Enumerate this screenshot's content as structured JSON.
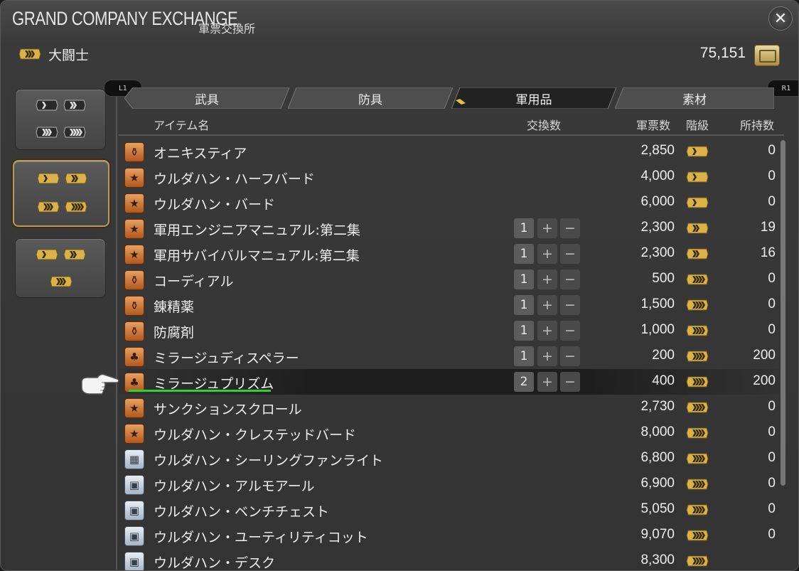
{
  "window": {
    "title": "GRAND COMPANY EXCHANGE",
    "subtitle": "軍票交換所",
    "close_icon": "close-icon"
  },
  "player": {
    "rank_name": "大闘士",
    "seals": "75,151"
  },
  "side": {
    "groups": [
      {
        "name": "rank-group-1",
        "active": false
      },
      {
        "name": "rank-group-2",
        "active": true
      },
      {
        "name": "rank-group-3",
        "active": false
      }
    ]
  },
  "controls": {
    "l1": "L1",
    "r1": "R1"
  },
  "tabs": [
    {
      "label": "武具",
      "active": false
    },
    {
      "label": "防具",
      "active": false
    },
    {
      "label": "軍用品",
      "active": true
    },
    {
      "label": "素材",
      "active": false
    }
  ],
  "columns": {
    "name": "アイテム名",
    "exchange": "交換数",
    "cost": "軍票数",
    "rank": "階級",
    "owned": "所持数"
  },
  "items": [
    {
      "name": "オニキスティア",
      "icon": "potion-icon",
      "color": "orange",
      "qty": "",
      "cost": "2,850",
      "rank": 1,
      "owned": "0"
    },
    {
      "name": "ウルダハン・ハーフバード",
      "icon": "star-icon",
      "color": "orange",
      "qty": "",
      "cost": "4,000",
      "rank": 1,
      "owned": "0"
    },
    {
      "name": "ウルダハン・バード",
      "icon": "star-icon",
      "color": "orange",
      "qty": "",
      "cost": "6,000",
      "rank": 1,
      "owned": "0"
    },
    {
      "name": "軍用エンジニアマニュアル:第二集",
      "icon": "star-icon",
      "color": "orange",
      "qty": "1",
      "cost": "2,300",
      "rank": 2,
      "owned": "19"
    },
    {
      "name": "軍用サバイバルマニュアル:第二集",
      "icon": "star-icon",
      "color": "orange",
      "qty": "1",
      "cost": "2,300",
      "rank": 2,
      "owned": "16"
    },
    {
      "name": "コーディアル",
      "icon": "potion-icon",
      "color": "orange",
      "qty": "1",
      "cost": "500",
      "rank": 3,
      "owned": "0"
    },
    {
      "name": "錬精薬",
      "icon": "potion-icon",
      "color": "orange",
      "qty": "1",
      "cost": "1,500",
      "rank": 3,
      "owned": "0"
    },
    {
      "name": "防腐剤",
      "icon": "potion-icon",
      "color": "orange",
      "qty": "1",
      "cost": "1,000",
      "rank": 3,
      "owned": "0"
    },
    {
      "name": "ミラージュディスペラー",
      "icon": "crystal-icon",
      "color": "orange",
      "qty": "1",
      "cost": "200",
      "rank": 3,
      "owned": "200"
    },
    {
      "name": "ミラージュプリズム",
      "icon": "crystal-icon",
      "color": "orange",
      "qty": "2",
      "cost": "400",
      "rank": 3,
      "owned": "200",
      "selected": true
    },
    {
      "name": "サンクションスクロール",
      "icon": "star-icon",
      "color": "orange",
      "qty": "",
      "cost": "2,730",
      "rank": 3,
      "owned": "0"
    },
    {
      "name": "ウルダハン・クレステッドバード",
      "icon": "star-icon",
      "color": "orange",
      "qty": "",
      "cost": "8,000",
      "rank": 3,
      "owned": "0"
    },
    {
      "name": "ウルダハン・シーリングファンライト",
      "icon": "ceiling-light-icon",
      "color": "blue",
      "qty": "",
      "cost": "6,800",
      "rank": 3,
      "owned": "0"
    },
    {
      "name": "ウルダハン・アルモアール",
      "icon": "furniture-icon",
      "color": "blue",
      "qty": "",
      "cost": "6,900",
      "rank": 3,
      "owned": "0"
    },
    {
      "name": "ウルダハン・ベンチチェスト",
      "icon": "furniture-icon",
      "color": "blue",
      "qty": "",
      "cost": "5,050",
      "rank": 3,
      "owned": "0"
    },
    {
      "name": "ウルダハン・ユーティリティコット",
      "icon": "furniture-icon",
      "color": "blue",
      "qty": "",
      "cost": "9,070",
      "rank": 3,
      "owned": "0"
    },
    {
      "name": "ウルダハン・デスク",
      "icon": "furniture-icon",
      "color": "blue",
      "qty": "",
      "cost": "8,300",
      "rank": 3,
      "owned": ""
    }
  ],
  "colors": {
    "accent_gold": "#d9b24a",
    "chip_dark": "#3a3a3a",
    "selection_underline": "#2cd52c",
    "active_border": "#b89a5e"
  }
}
